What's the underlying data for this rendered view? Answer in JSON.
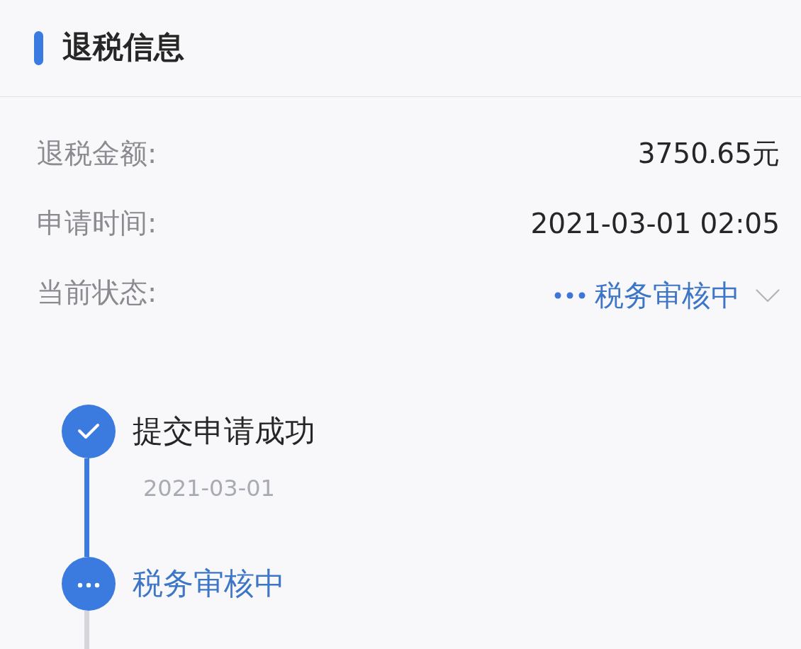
{
  "section": {
    "title": "退税信息"
  },
  "fields": [
    {
      "kind": "text",
      "label": "退税金额:",
      "value": "3750.65元"
    },
    {
      "kind": "text",
      "label": "申请时间:",
      "value": "2021-03-01 02:05"
    },
    {
      "kind": "status",
      "label": "当前状态:",
      "value": "税务审核中",
      "expanded": false
    }
  ],
  "timeline": [
    {
      "kind": "done",
      "title": "提交申请成功",
      "date": "2021-03-01"
    },
    {
      "kind": "current",
      "title": "税务审核中"
    }
  ]
}
